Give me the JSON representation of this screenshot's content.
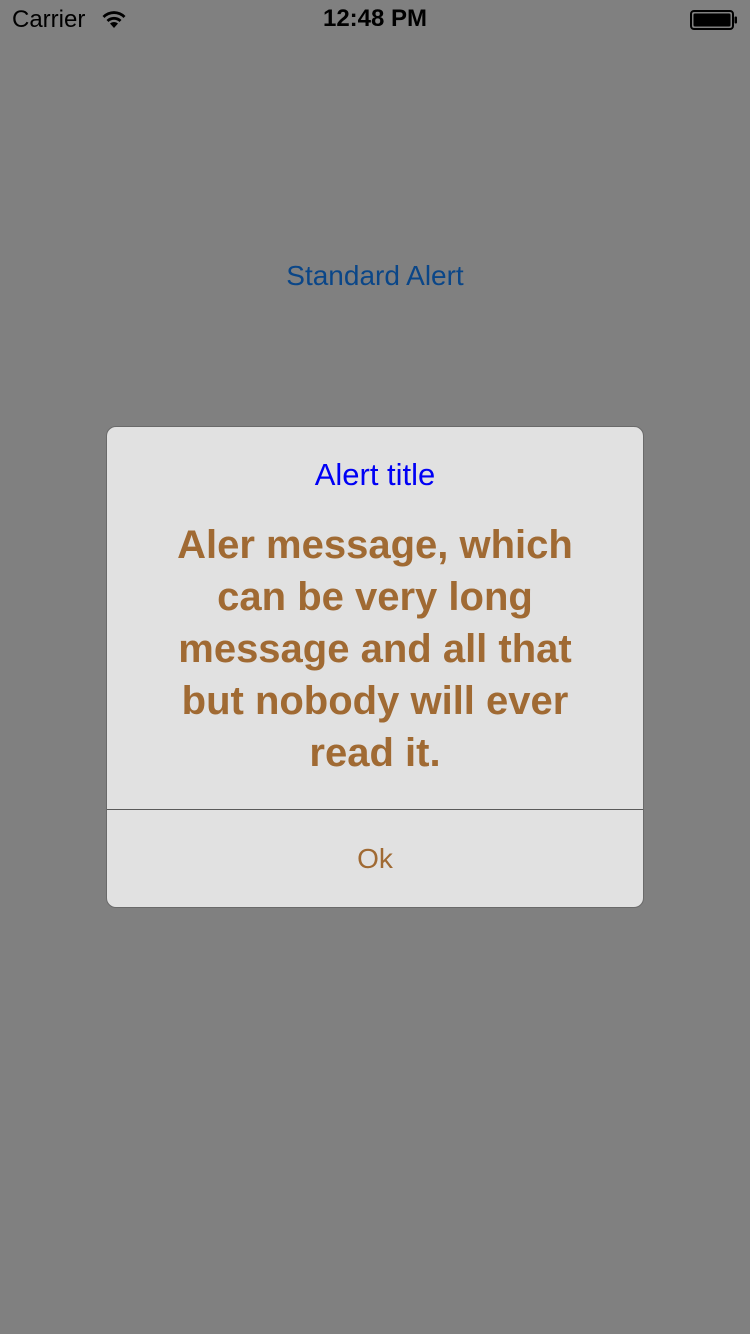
{
  "status_bar": {
    "carrier": "Carrier",
    "time": "12:48 PM",
    "wifi_icon": "wifi-icon",
    "battery_icon": "battery-icon"
  },
  "main": {
    "standard_alert_label": "Standard Alert"
  },
  "alert": {
    "title": "Alert title",
    "message": "Aler message, which can be very long message and all that but nobody will ever read it.",
    "ok_label": "Ok"
  },
  "colors": {
    "overlay": "#808080",
    "alert_background": "#e1e1e1",
    "title_color": "#0000f5",
    "message_color": "#a06a33",
    "button_color": "#a06a33",
    "link_color": "#0a4688"
  }
}
